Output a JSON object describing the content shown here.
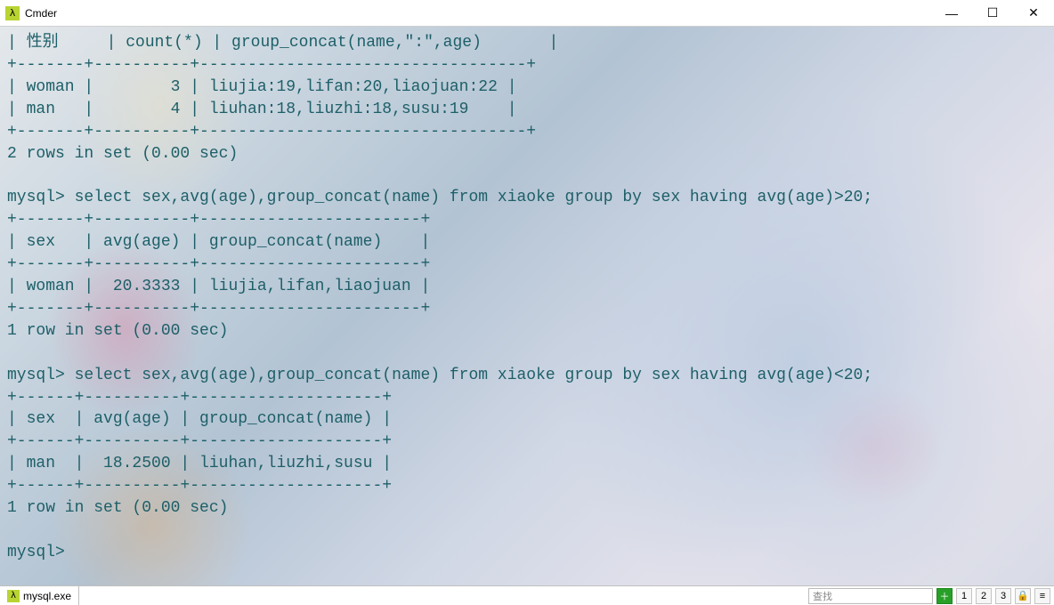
{
  "window": {
    "title": "Cmder",
    "icon_glyph": "λ",
    "controls": {
      "minimize": "—",
      "maximize": "☐",
      "close": "✕"
    }
  },
  "terminal": {
    "l0": "| 性别     | count(*) | group_concat(name,\":\",age)       |",
    "l1": "+-------+----------+----------------------------------+",
    "l2": "| woman |        3 | liujia:19,lifan:20,liaojuan:22 |",
    "l3": "| man   |        4 | liuhan:18,liuzhi:18,susu:19    |",
    "l4": "+-------+----------+----------------------------------+",
    "l5": "2 rows in set (0.00 sec)",
    "l6": "",
    "l7": "mysql> select sex,avg(age),group_concat(name) from xiaoke group by sex having avg(age)>20;",
    "l8": "+-------+----------+-----------------------+",
    "l9": "| sex   | avg(age) | group_concat(name)    |",
    "l10": "+-------+----------+-----------------------+",
    "l11": "| woman |  20.3333 | liujia,lifan,liaojuan |",
    "l12": "+-------+----------+-----------------------+",
    "l13": "1 row in set (0.00 sec)",
    "l14": "",
    "l15": "mysql> select sex,avg(age),group_concat(name) from xiaoke group by sex having avg(age)<20;",
    "l16": "+------+----------+--------------------+",
    "l17": "| sex  | avg(age) | group_concat(name) |",
    "l18": "+------+----------+--------------------+",
    "l19": "| man  |  18.2500 | liuhan,liuzhi,susu |",
    "l20": "+------+----------+--------------------+",
    "l21": "1 row in set (0.00 sec)",
    "l22": "",
    "l23": "mysql>"
  },
  "statusbar": {
    "tab_icon_glyph": "λ",
    "tab_label": "mysql.exe",
    "search_placeholder": "查找",
    "plus_glyph": "＋",
    "num1_glyph": "1",
    "num2_glyph": "2",
    "num3_glyph": "3",
    "lock_glyph": "🔒",
    "menu_glyph": "≡"
  }
}
